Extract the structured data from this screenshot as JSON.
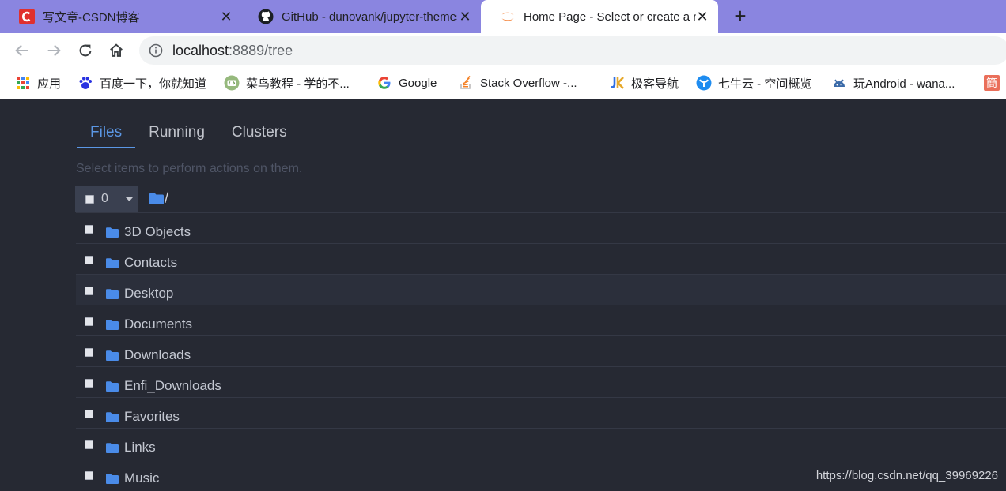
{
  "browser": {
    "tabs": [
      {
        "title": "写文章-CSDN博客",
        "active": false,
        "icon": "csdn-icon"
      },
      {
        "title": "GitHub - dunovank/jupyter-themes",
        "active": false,
        "icon": "github-icon"
      },
      {
        "title": "Home Page - Select or create a notebook",
        "active": true,
        "icon": "jupyter-icon"
      }
    ],
    "new_tab_icon": "plus-icon",
    "url": {
      "host": "localhost",
      "rest": ":8889/tree"
    },
    "bookmarks": [
      {
        "label": "应用",
        "icon": "apps-grid-icon"
      },
      {
        "label": "百度一下，你就知道",
        "icon": "baidu-icon"
      },
      {
        "label": "菜鸟教程 - 学的不...",
        "icon": "runoob-icon"
      },
      {
        "label": "Google",
        "icon": "google-icon"
      },
      {
        "label": "Stack Overflow -...",
        "icon": "stackoverflow-icon"
      },
      {
        "label": "极客导航",
        "icon": "jike-icon"
      },
      {
        "label": "七牛云 - 空间概览",
        "icon": "qiniu-icon"
      },
      {
        "label": "玩Android - wana...",
        "icon": "android-icon"
      },
      {
        "label": "簡",
        "icon": "jianshu-icon"
      }
    ]
  },
  "jupyter": {
    "tabs": [
      "Files",
      "Running",
      "Clusters"
    ],
    "active_tab": "Files",
    "hint": "Select items to perform actions on them.",
    "selected_count": "0",
    "breadcrumb": "/",
    "items": [
      "3D Objects",
      "Contacts",
      "Desktop",
      "Documents",
      "Downloads",
      "Enfi_Downloads",
      "Favorites",
      "Links",
      "Music"
    ],
    "hovered_item": "Desktop"
  },
  "watermark": "https://blog.csdn.net/qq_39969226",
  "colors": {
    "tab_strip": "#8a85e0",
    "accent": "#5b97e5",
    "page_bg": "#262933",
    "folder": "#4a8be8"
  }
}
